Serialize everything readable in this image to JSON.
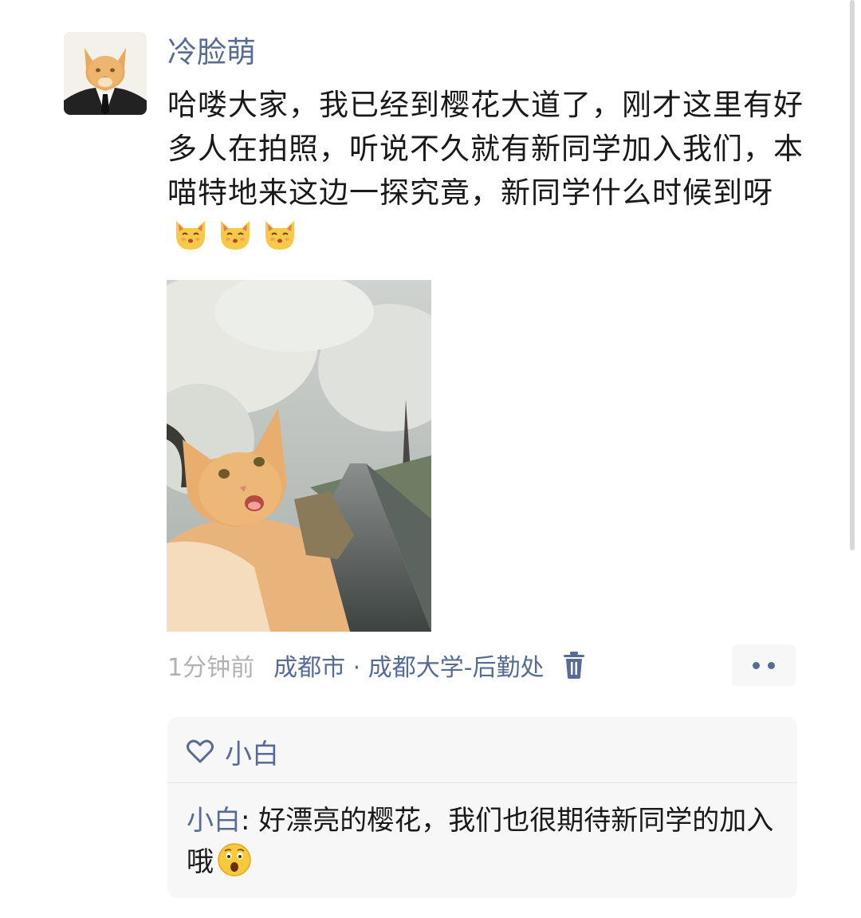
{
  "post": {
    "author": "冷脸萌",
    "text": "哈喽大家，我已经到樱花大道了，刚才这里有好多人在拍照，听说不久就有新同学加入我们，本喵特地来这边一探究竟，新同学什么时候到呀",
    "emojis": [
      "kissing-cat-icon",
      "kissing-cat-icon",
      "kissing-cat-icon"
    ],
    "time": "1分钟前",
    "location": "成都市 · 成都大学-后勤处"
  },
  "likes": {
    "names": "小白"
  },
  "comments": [
    {
      "author": "小白",
      "separator": ": ",
      "text": "好漂亮的樱花，我们也很期待新同学的加入哦",
      "emoji": "astonished-face-icon"
    }
  ],
  "colors": {
    "link": "#576b95",
    "text": "#191919",
    "muted": "#b2b2b2",
    "panel": "#f7f7f7"
  }
}
